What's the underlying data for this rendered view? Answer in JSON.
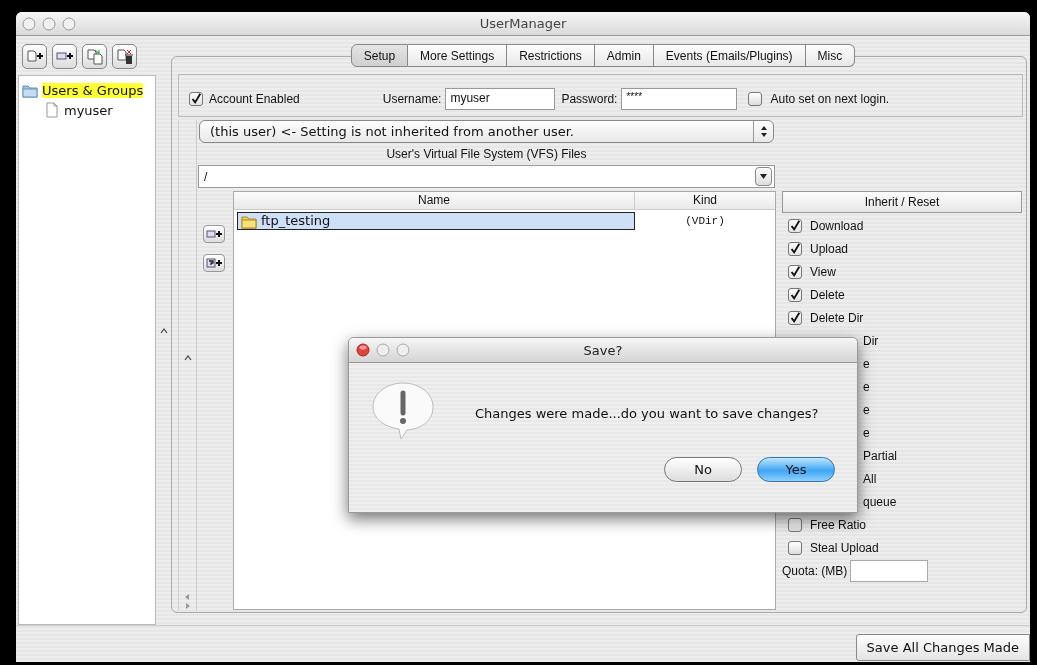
{
  "window": {
    "title": "UserManager"
  },
  "tree": {
    "items": [
      {
        "label": "Users & Groups",
        "selected": true,
        "children": [
          {
            "label": "myuser",
            "selected": false
          }
        ]
      }
    ]
  },
  "tabs": [
    {
      "label": "Setup",
      "selected": true
    },
    {
      "label": "More Settings",
      "selected": false
    },
    {
      "label": "Restrictions",
      "selected": false
    },
    {
      "label": "Admin",
      "selected": false
    },
    {
      "label": "Events (Emails/Plugins)",
      "selected": false
    },
    {
      "label": "Misc",
      "selected": false
    }
  ],
  "account": {
    "enabled": {
      "label": "Account Enabled",
      "checked": true
    },
    "username": {
      "label": "Username:",
      "value": "myuser"
    },
    "password": {
      "label": "Password:",
      "value": "****"
    },
    "auto_set": {
      "label": "Auto set on next login.",
      "checked": false
    }
  },
  "inherit_select": {
    "value": "(this user) <- Setting is not inherited from another user."
  },
  "vfs": {
    "title": "User's Virtual File System (VFS) Files",
    "path": "/",
    "table": {
      "columns": [
        "Name",
        "Kind"
      ],
      "rows": [
        {
          "name": "ftp_testing",
          "kind": "(VDir)",
          "selected": true
        }
      ]
    }
  },
  "permissions": {
    "reset_button": "Inherit / Reset",
    "items": [
      {
        "label": "Download",
        "checked": true,
        "covered": false
      },
      {
        "label": "Upload",
        "checked": true,
        "covered": false
      },
      {
        "label": "View",
        "checked": true,
        "covered": false
      },
      {
        "label": "Delete",
        "checked": true,
        "covered": false
      },
      {
        "label": "Delete Dir",
        "checked": true,
        "covered": false
      },
      {
        "label": "Dir",
        "covered": true
      },
      {
        "label": "e",
        "covered": true
      },
      {
        "label": "e",
        "covered": true
      },
      {
        "label": "e",
        "covered": true
      },
      {
        "label": "e",
        "covered": true
      },
      {
        "label": "Partial",
        "covered": true
      },
      {
        "label": "All",
        "covered": true
      },
      {
        "label": "queue",
        "covered": true
      },
      {
        "label": "Free Ratio",
        "checked": false,
        "covered": false
      },
      {
        "label": "Steal Upload",
        "checked": false,
        "covered": false
      }
    ],
    "quota": {
      "label": "Quota: (MB)"
    }
  },
  "dialog": {
    "title": "Save?",
    "message": "Changes were made...do you want to save changes?",
    "buttons": [
      {
        "label": "No",
        "default": false
      },
      {
        "label": "Yes",
        "default": true
      }
    ]
  },
  "save_button": "Save All Changes Made"
}
